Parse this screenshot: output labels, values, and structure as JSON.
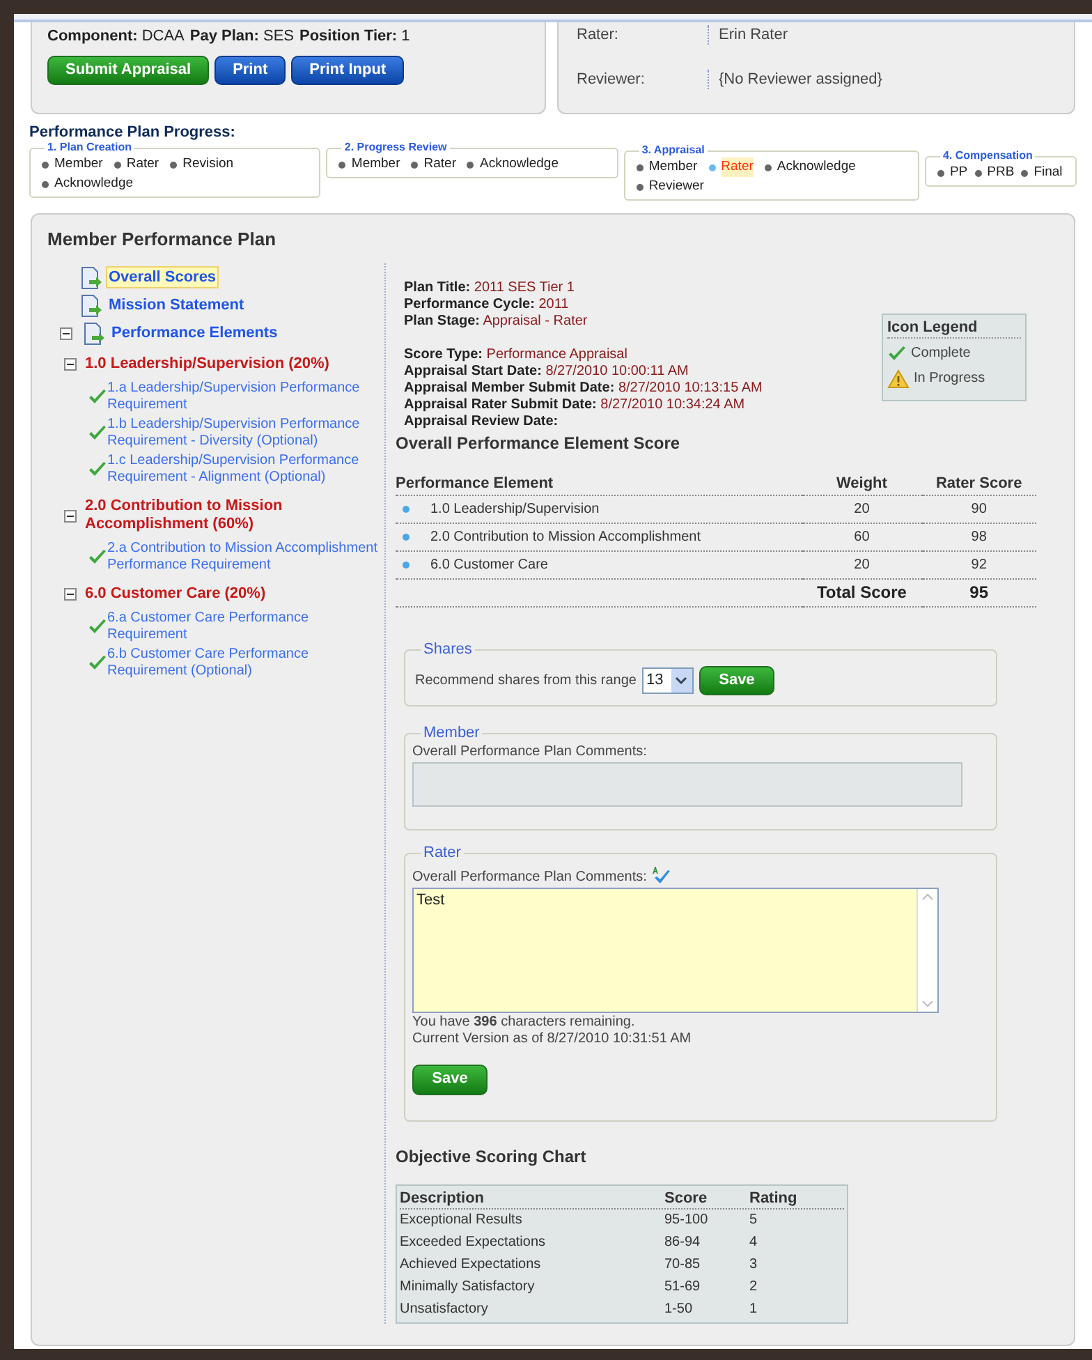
{
  "header": {
    "fields": [
      {
        "label": "Component:",
        "value": "DCAA"
      },
      {
        "label": "Pay Plan:",
        "value": "SES"
      },
      {
        "label": "Position Tier:",
        "value": "1"
      }
    ],
    "buttons": [
      {
        "label": "Submit Appraisal",
        "kind": "primary"
      },
      {
        "label": "Print",
        "kind": "secondary"
      },
      {
        "label": "Print Input",
        "kind": "secondary"
      }
    ],
    "people": [
      {
        "label": "Rater:",
        "value": "Erin Rater"
      },
      {
        "label": "Reviewer:",
        "value": "{No Reviewer assigned}"
      }
    ]
  },
  "progress": {
    "title": "Performance Plan Progress:",
    "stages": [
      {
        "title": "1. Plan Creation",
        "steps": [
          {
            "label": "Member",
            "selected": false
          },
          {
            "label": "Rater",
            "selected": false
          },
          {
            "label": "Revision",
            "selected": false
          },
          {
            "label": "Acknowledge",
            "selected": false
          }
        ]
      },
      {
        "title": "2. Progress Review",
        "steps": [
          {
            "label": "Member",
            "selected": false
          },
          {
            "label": "Rater",
            "selected": false
          },
          {
            "label": "Acknowledge",
            "selected": false
          }
        ]
      },
      {
        "title": "3. Appraisal",
        "steps": [
          {
            "label": "Member",
            "selected": false
          },
          {
            "label": "Rater",
            "selected": true
          },
          {
            "label": "Acknowledge",
            "selected": false
          },
          {
            "label": "Reviewer",
            "selected": false
          }
        ]
      },
      {
        "title": "4. Compensation",
        "steps": [
          {
            "label": "PP",
            "selected": false
          },
          {
            "label": "PRB",
            "selected": false
          },
          {
            "label": "Final",
            "selected": false
          }
        ]
      }
    ]
  },
  "plan": {
    "title": "Member Performance Plan",
    "nav": [
      {
        "label": "Overall Scores",
        "selected": true
      },
      {
        "label": "Mission Statement",
        "selected": false
      },
      {
        "label": "Performance Elements",
        "selected": false,
        "expanded": true,
        "children": [
          {
            "label": "1.0 Leadership/Supervision (20%)",
            "expanded": true,
            "children": [
              {
                "label": "1.a Leadership/Supervision Performance Requirement",
                "kind": "complete"
              },
              {
                "label": "1.b Leadership/Supervision Performance Requirement - Diversity (Optional)",
                "kind": "complete"
              },
              {
                "label": "1.c Leadership/Supervision Performance Requirement - Alignment (Optional)",
                "kind": "complete"
              }
            ]
          },
          {
            "label": "2.0 Contribution to Mission Accomplishment (60%)",
            "expanded": true,
            "children": [
              {
                "label": "2.a Contribution to Mission Accomplishment Performance Requirement",
                "kind": "complete"
              }
            ]
          },
          {
            "label": "6.0 Customer Care (20%)",
            "expanded": true,
            "children": [
              {
                "label": "6.a Customer Care Performance Requirement",
                "kind": "complete"
              },
              {
                "label": "6.b Customer Care Performance Requirement (Optional)",
                "kind": "complete"
              }
            ]
          }
        ]
      }
    ],
    "info": [
      [
        {
          "label": "Plan Title:",
          "value": "2011 SES Tier 1"
        },
        {
          "label": "Performance Cycle:",
          "value": "2011"
        },
        {
          "label": "Plan Stage:",
          "value": "Appraisal - Rater"
        }
      ],
      [
        {
          "label": "Score Type:",
          "value": "Performance Appraisal"
        },
        {
          "label": "Appraisal Start Date:",
          "value": "8/27/2010 10:00:11 AM"
        },
        {
          "label": "Appraisal Member Submit Date:",
          "value": "8/27/2010 10:13:15 AM"
        },
        {
          "label": "Appraisal Rater Submit Date:",
          "value": "8/27/2010 10:34:24 AM"
        },
        {
          "label": "Appraisal Review Date:"
        }
      ]
    ],
    "legend": {
      "title": "Icon Legend",
      "items": [
        {
          "label": "Complete",
          "kind": "complete"
        },
        {
          "label": "In Progress",
          "kind": "in_progress"
        }
      ]
    },
    "score_table": {
      "title": "Overall Performance Element Score",
      "columns": [
        "Performance Element",
        "Weight",
        "Rater Score"
      ],
      "rows": [
        [
          "1.0 Leadership/Supervision",
          "20",
          "90"
        ],
        [
          "2.0 Contribution to Mission Accomplishment",
          "60",
          "98"
        ],
        [
          "6.0 Customer Care",
          "20",
          "92"
        ]
      ],
      "total": {
        "label": "Total Score",
        "value": "95"
      }
    },
    "shares": {
      "legend": "Shares",
      "label": "Recommend shares from this range",
      "value": "13",
      "button": "Save"
    },
    "member": {
      "legend": "Member",
      "label": "Overall Performance Plan Comments:",
      "disabled": true
    },
    "rater": {
      "legend": "Rater",
      "label": "Overall Performance Plan Comments:",
      "value": "Test",
      "remaining": "You have **396** characters remaining.",
      "version": "Current Version as of 8/27/2010 10:31:51 AM",
      "button": "Save"
    },
    "scoring": {
      "title": "Objective Scoring Chart",
      "columns": [
        "Description",
        "Score",
        "Rating"
      ],
      "rows": [
        [
          "Exceptional Results",
          "95-100",
          "5"
        ],
        [
          "Exceeded Expectations",
          "86-94",
          "4"
        ],
        [
          "Achieved Expectations",
          "70-85",
          "3"
        ],
        [
          "Minimally Satisfactory",
          "51-69",
          "2"
        ],
        [
          "Unsatisfactory",
          "1-50",
          "1"
        ]
      ]
    }
  }
}
